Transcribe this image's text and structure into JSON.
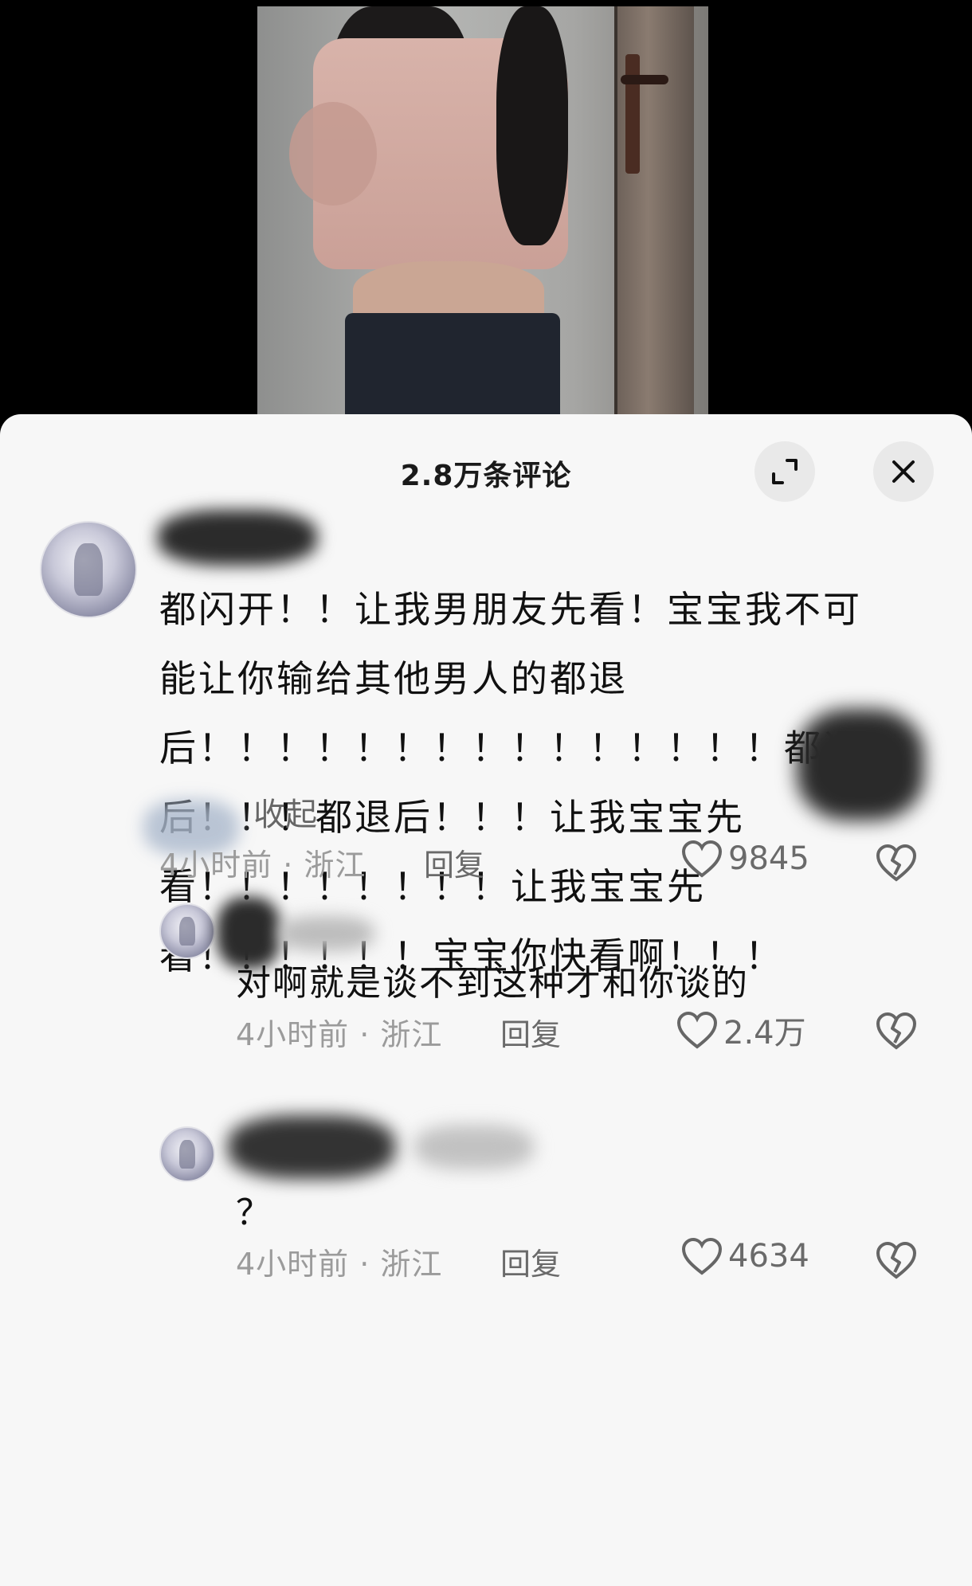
{
  "header": {
    "title": "2.8万条评论"
  },
  "comments": [
    {
      "text": "都闪开！！让我男朋友先看！宝宝我不可\n能让你输给其他男人的都退\n后！！！！！！！！！！！！！！！都退\n后！！！都退后！！！让我宝宝先\n看！！！！！！！！让我宝宝先\n看！！！！！！宝宝你快看啊！！！",
      "collapse_label": "收起",
      "time_location": "4小时前 · 浙江",
      "reply_label": "回复",
      "likes": "9845"
    }
  ],
  "replies": [
    {
      "text": "对啊就是谈不到这种才和你谈的",
      "time_location": "4小时前 · 浙江",
      "reply_label": "回复",
      "likes": "2.4万"
    },
    {
      "text": "？",
      "time_location": "4小时前 · 浙江",
      "reply_label": "回复",
      "likes": "4634"
    }
  ],
  "icons": {
    "expand": "expand-icon",
    "close": "close-icon",
    "like": "heart-outline-icon",
    "dislike": "broken-heart-icon"
  },
  "colors": {
    "sheet_bg": "#f7f7f7",
    "meta_text": "#9b9b9b",
    "button_bg": "#e9e9e9"
  }
}
